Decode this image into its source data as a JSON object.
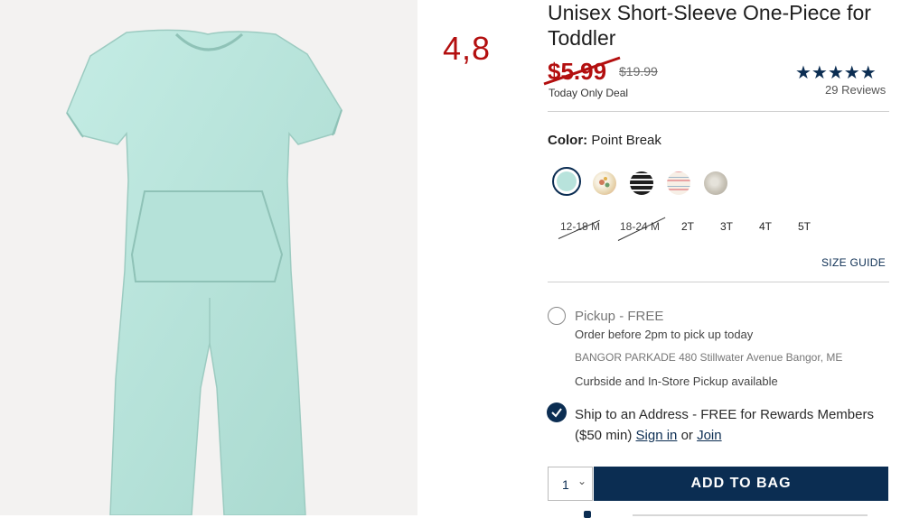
{
  "product": {
    "title": "Unisex Short-Sleeve One-Piece for Toddler",
    "sale_price": "$5.99",
    "original_price": "$19.99",
    "deal_label": "Today Only Deal",
    "rating_overlay": "4,8",
    "stars": "★★★★★",
    "reviews": "29 Reviews",
    "image_icon": "romper-product-photo"
  },
  "color": {
    "label": "Color:",
    "selected": "Point Break",
    "swatches": [
      "Point Break",
      "Floral",
      "Black Stripe",
      "Pink Stripe",
      "Grey Print"
    ]
  },
  "sizes": [
    {
      "label": "12-18 M",
      "available": false
    },
    {
      "label": "18-24 M",
      "available": false
    },
    {
      "label": "2T",
      "available": true
    },
    {
      "label": "3T",
      "available": true
    },
    {
      "label": "4T",
      "available": true
    },
    {
      "label": "5T",
      "available": true
    }
  ],
  "size_guide": "SIZE GUIDE",
  "pickup": {
    "title": "Pickup - FREE",
    "subtitle": "Order before 2pm to pick up today",
    "store": "BANGOR PARKADE 480 Stillwater Avenue  Bangor, ME",
    "curbside": "Curbside and In-Store Pickup available"
  },
  "ship": {
    "text": "Ship to an Address - FREE for Rewards Members ($50 min)",
    "sign_in": "Sign in",
    "or": "or",
    "join": "Join"
  },
  "cart": {
    "quantity": "1",
    "add_label": "ADD TO BAG"
  },
  "colors": {
    "accent": "#0b2d52",
    "sale": "#b30f0f",
    "romper": "#b8e3dc"
  }
}
